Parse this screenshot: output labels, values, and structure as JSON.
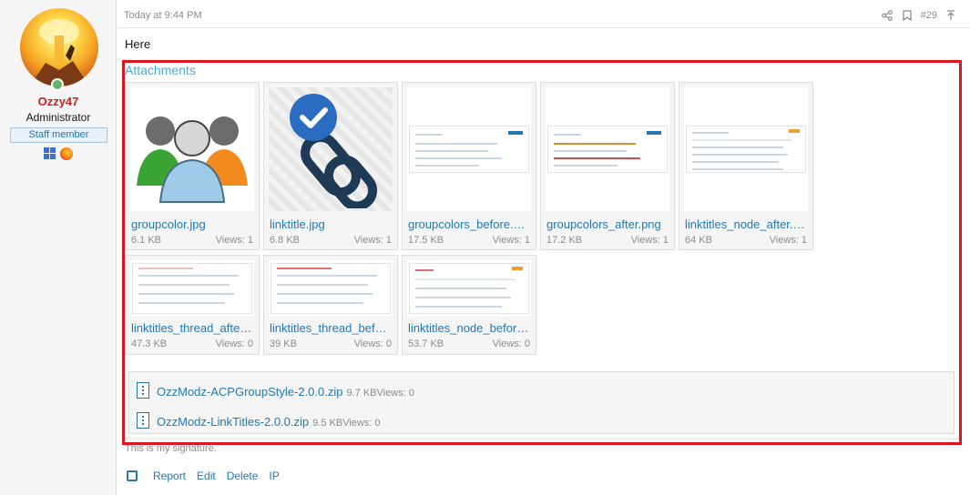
{
  "user": {
    "name": "Ozzy47",
    "title": "Administrator",
    "badge": "Staff member",
    "os_icon": "windows-icon",
    "browser_icon": "firefox-icon"
  },
  "post": {
    "date": "Today at 9:44 PM",
    "number": "#29",
    "message": "Here",
    "icons": [
      "share-icon",
      "bookmark-icon",
      "arrow-up-icon"
    ]
  },
  "attachments": {
    "title": "Attachments",
    "images": [
      {
        "filename": "groupcolor.jpg",
        "size": "6.1 KB",
        "views": "Views: 1"
      },
      {
        "filename": "linktitle.jpg",
        "size": "6.8 KB",
        "views": "Views: 1"
      },
      {
        "filename": "groupcolors_before.png",
        "size": "17.5 KB",
        "views": "Views: 1"
      },
      {
        "filename": "groupcolors_after.png",
        "size": "17.2 KB",
        "views": "Views: 1"
      },
      {
        "filename": "linktitles_node_after.png",
        "size": "64 KB",
        "views": "Views: 1"
      },
      {
        "filename": "linktitles_thread_after.png",
        "size": "47.3 KB",
        "views": "Views: 0"
      },
      {
        "filename": "linktitles_thread_before.png",
        "size": "39 KB",
        "views": "Views: 0"
      },
      {
        "filename": "linktitles_node_before.png",
        "size": "53.7 KB",
        "views": "Views: 0"
      }
    ],
    "files": [
      {
        "filename": "OzzModz-ACPGroupStyle-2.0.0.zip",
        "meta": "9.7 KBViews: 0"
      },
      {
        "filename": "OzzModz-LinkTitles-2.0.0.zip",
        "meta": "9.5 KBViews: 0"
      }
    ]
  },
  "signature": "This is my signature.",
  "actions": {
    "report": "Report",
    "edit": "Edit",
    "delete": "Delete",
    "ip": "IP"
  },
  "colors": {
    "link": "#2577b1",
    "highlight": "#e0141e",
    "username": "#d81b1b"
  }
}
